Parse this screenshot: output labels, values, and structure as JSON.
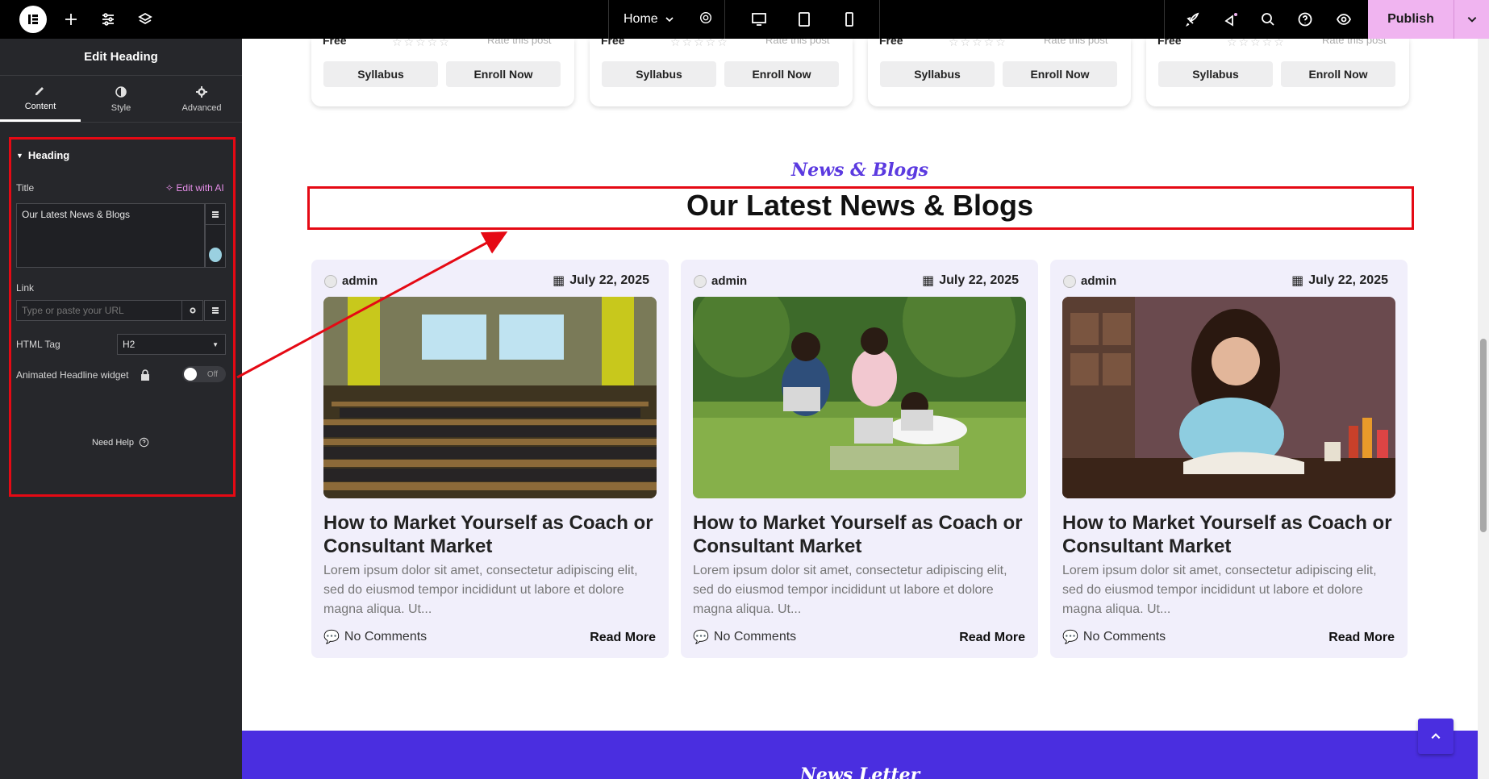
{
  "topbar": {
    "home_label": "Home",
    "publish_label": "Publish"
  },
  "panel": {
    "title": "Edit Heading",
    "tabs": [
      {
        "label": "Content",
        "icon": "pencil-icon"
      },
      {
        "label": "Style",
        "icon": "half-circle-icon"
      },
      {
        "label": "Advanced",
        "icon": "gear-icon"
      }
    ],
    "section_heading": "Heading",
    "title_label": "Title",
    "edit_ai_label": "Edit with AI",
    "title_value": "Our Latest News & Blogs",
    "link_label": "Link",
    "link_placeholder": "Type or paste your URL",
    "html_tag_label": "HTML Tag",
    "html_tag_value": "H2",
    "animated_label": "Animated Headline widget",
    "toggle_state": "Off",
    "need_help": "Need Help"
  },
  "courses": {
    "price": "Free",
    "rate_text": "Rate this post",
    "syllabus_label": "Syllabus",
    "enroll_label": "Enroll Now"
  },
  "section": {
    "eyebrow": "News & Blogs",
    "heading": "Our Latest News & Blogs"
  },
  "posts": [
    {
      "author": "admin",
      "date": "July 22, 2025",
      "title": "How to Market Yourself as Coach or Consultant Market",
      "excerpt": "Lorem ipsum dolor sit amet, consectetur adipiscing elit, sed do eiusmod tempor incididunt ut labore et dolore magna aliqua. Ut...",
      "comments": "No Comments",
      "read_more": "Read More"
    },
    {
      "author": "admin",
      "date": "July 22, 2025",
      "title": "How to Market Yourself as Coach or Consultant Market",
      "excerpt": "Lorem ipsum dolor sit amet, consectetur adipiscing elit, sed do eiusmod tempor incididunt ut labore et dolore magna aliqua. Ut...",
      "comments": "No Comments",
      "read_more": "Read More"
    },
    {
      "author": "admin",
      "date": "July 22, 2025",
      "title": "How to Market Yourself as Coach or Consultant Market",
      "excerpt": "Lorem ipsum dolor sit amet, consectetur adipiscing elit, sed do eiusmod tempor incididunt ut labore et dolore magna aliqua. Ut...",
      "comments": "No Comments",
      "read_more": "Read More"
    }
  ],
  "newsletter": {
    "label": "News Letter"
  },
  "colors": {
    "accent": "#5b3ae0",
    "publish": "#f0b4f0",
    "highlight": "#e50914",
    "panel_bg": "#26272b"
  }
}
